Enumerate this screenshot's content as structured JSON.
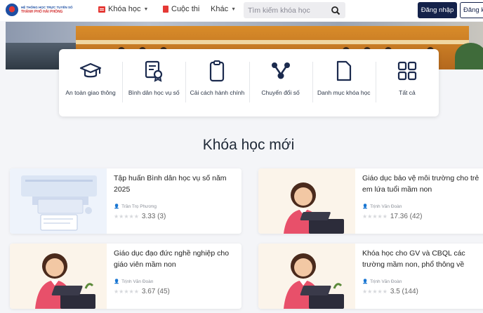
{
  "header": {
    "logo_line1": "HỆ THỐNG HỌC TRỰC TUYẾN SỐ",
    "logo_line2": "THÀNH PHỐ HẢI PHÒNG",
    "nav": {
      "khoahoc": "Khóa học",
      "cuocthi": "Cuộc thi",
      "khac": "Khác"
    },
    "search_placeholder": "Tìm kiếm khóa học",
    "login": "Đăng nhập",
    "register": "Đăng ký"
  },
  "categories": [
    {
      "label": "An toàn giao thông",
      "icon": "graduation-cap-icon"
    },
    {
      "label": "Bình dân học vụ số",
      "icon": "certificate-icon"
    },
    {
      "label": "Cải cách hành chính",
      "icon": "clipboard-icon"
    },
    {
      "label": "Chuyển đổi số",
      "icon": "network-icon"
    },
    {
      "label": "Danh mục khóa học",
      "icon": "document-icon"
    },
    {
      "label": "Tất cả",
      "icon": "grid-icon"
    }
  ],
  "section_title": "Khóa học mới",
  "courses": [
    {
      "title": "Tập huấn Bình dân học vụ số năm 2025",
      "author": "Trần Trọ Phương",
      "rating": "3.33 (3)"
    },
    {
      "title": "Giáo dục bảo vệ môi trường cho trẻ em lứa tuổi mầm non",
      "author": "Trịnh Văn Đoàn",
      "rating": "17.36 (42)"
    },
    {
      "title": "Giáo dục đạo đức nghề nghiệp cho giáo viên mầm non",
      "author": "Trịnh Văn Đoàn",
      "rating": "3.67 (45)"
    },
    {
      "title": "Khóa học cho GV và CBQL các trường mầm non, phổ thông về",
      "author": "Trịnh Văn Đoàn",
      "rating": "3.5 (144)"
    }
  ],
  "stars_glyph": "★★★★★",
  "colors": {
    "brand": "#14224a",
    "accent": "#e53935"
  }
}
